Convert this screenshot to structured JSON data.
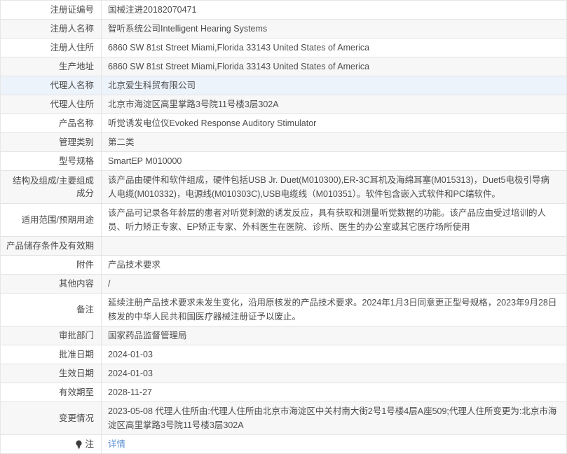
{
  "table": {
    "rows": [
      {
        "label": "注册证编号",
        "value": "国械注进20182070471"
      },
      {
        "label": "注册人名称",
        "value": "智听系统公司Intelligent Hearing Systems"
      },
      {
        "label": "注册人住所",
        "value": "6860 SW 81st Street Miami,Florida 33143 United States of America"
      },
      {
        "label": "生产地址",
        "value": "6860 SW 81st Street Miami,Florida 33143 United States of America"
      },
      {
        "label": "代理人名称",
        "value": "北京爱生科贸有限公司"
      },
      {
        "label": "代理人住所",
        "value": "北京市海淀区高里掌路3号院11号楼3层302A"
      },
      {
        "label": "产品名称",
        "value": "听觉诱发电位仪Evoked Response Auditory Stimulator"
      },
      {
        "label": "管理类别",
        "value": "第二类"
      },
      {
        "label": "型号规格",
        "value": "SmartEP M010000"
      },
      {
        "label": "结构及组成/主要组成成分",
        "value": "该产品由硬件和软件组成，硬件包括USB Jr. Duet(M010300),ER-3C耳机及海绵耳塞(M015313)，Duet5电极引导病人电缆(M010332)，电源线(M010303C),USB电缆线（M010351）。软件包含嵌入式软件和PC端软件。"
      },
      {
        "label": "适用范围/预期用途",
        "value": "该产品可记录各年龄层的患者对听觉刺激的诱发反应，具有获取和测量听觉数据的功能。该产品应由受过培训的人员、听力矫正专家、EP矫正专家、外科医生在医院、诊所、医生的办公室或其它医疗场所使用"
      },
      {
        "label": "产品储存条件及有效期",
        "value": ""
      },
      {
        "label": "附件",
        "value": "产品技术要求"
      },
      {
        "label": "其他内容",
        "value": "/"
      },
      {
        "label": "备注",
        "value": "延续注册产品技术要求未发生变化，沿用原核发的产品技术要求。2024年1月3日同意更正型号规格，2023年9月28日核发的中华人民共和国医疗器械注册证予以废止。"
      },
      {
        "label": "审批部门",
        "value": "国家药品监督管理局"
      },
      {
        "label": "批准日期",
        "value": "2024-01-03"
      },
      {
        "label": "生效日期",
        "value": "2024-01-03"
      },
      {
        "label": "有效期至",
        "value": "2028-11-27"
      },
      {
        "label": "变更情况",
        "value": "2023-05-08 代理人住所由:代理人住所由北京市海淀区中关村南大街2号1号楼4层A座509;代理人住所变更为:北京市海淀区高里掌路3号院11号楼3层302A"
      },
      {
        "label": "注",
        "value": "详情"
      }
    ],
    "colors": {
      "link": "#5e90d2",
      "even_row_bg": "#f7f7f7",
      "hover_row_bg": "#edf3fb",
      "border": "#e4e4e4"
    }
  }
}
